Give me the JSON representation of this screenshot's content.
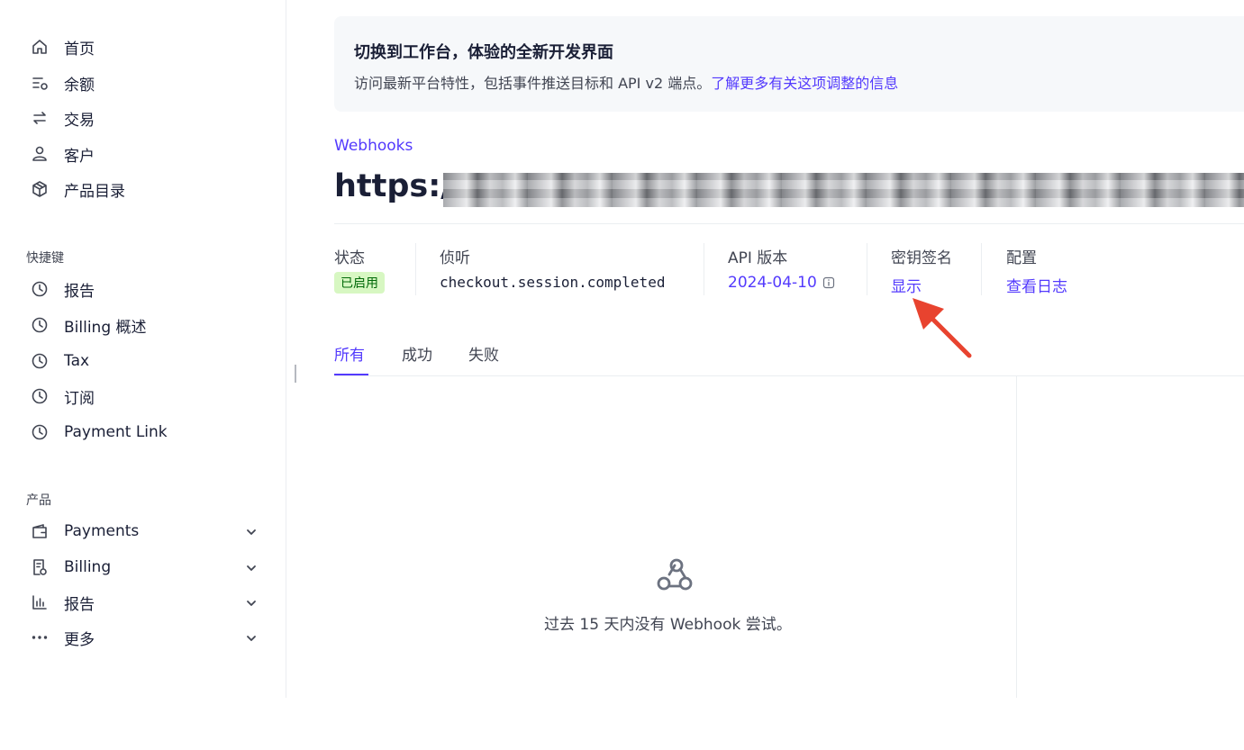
{
  "sidebar": {
    "main_items": [
      {
        "label": "首页",
        "icon": "home-icon"
      },
      {
        "label": "余额",
        "icon": "balance-icon"
      },
      {
        "label": "交易",
        "icon": "transactions-icon"
      },
      {
        "label": "客户",
        "icon": "customer-icon"
      },
      {
        "label": "产品目录",
        "icon": "box-icon"
      }
    ],
    "shortcuts_label": "快捷键",
    "shortcuts": [
      {
        "label": "报告",
        "icon": "clock-icon"
      },
      {
        "label": "Billing 概述",
        "icon": "clock-icon"
      },
      {
        "label": "Tax",
        "icon": "clock-icon"
      },
      {
        "label": "订阅",
        "icon": "clock-icon"
      },
      {
        "label": "Payment Link",
        "icon": "clock-icon"
      }
    ],
    "products_label": "产品",
    "products": [
      {
        "label": "Payments",
        "icon": "wallet-icon"
      },
      {
        "label": "Billing",
        "icon": "invoice-icon"
      },
      {
        "label": "报告",
        "icon": "bar-chart-icon"
      },
      {
        "label": "更多",
        "icon": "more-icon"
      }
    ]
  },
  "banner": {
    "title": "切换到工作台，体验的全新开发界面",
    "text": "访问最新平台特性，包括事件推送目标和 API v2 端点。",
    "link": "了解更多有关这项调整的信息"
  },
  "breadcrumb": "Webhooks",
  "endpoint": {
    "url_prefix": "https://"
  },
  "meta": {
    "status_label": "状态",
    "status_value": "已启用",
    "listen_label": "侦听",
    "listen_value": "checkout.session.completed",
    "api_label": "API 版本",
    "api_value": "2024-04-10",
    "secret_label": "密钥签名",
    "secret_value": "显示",
    "config_label": "配置",
    "config_value": "查看日志"
  },
  "tabs": [
    "所有",
    "成功",
    "失败"
  ],
  "empty_state": {
    "icon": "webhook-icon",
    "text": "过去 15 天内没有 Webhook 尝试。"
  },
  "colors": {
    "accent": "#533afd",
    "badge_bg": "#d7f7c2",
    "badge_text": "#006908",
    "annotation_arrow": "#e8432f"
  }
}
